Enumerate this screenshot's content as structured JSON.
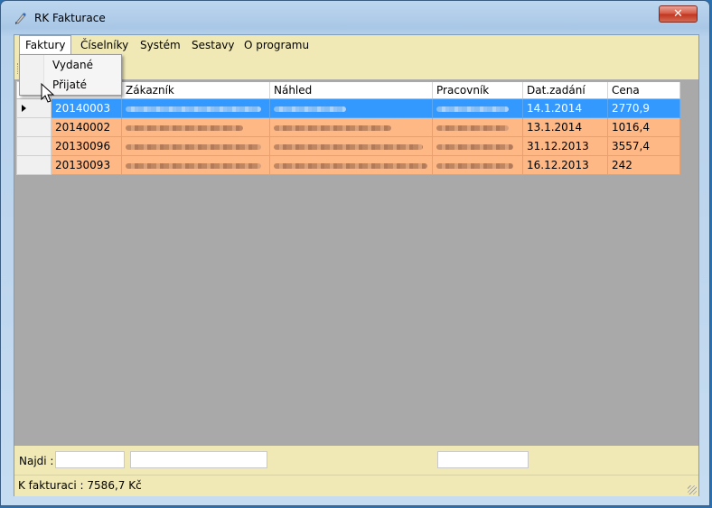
{
  "window": {
    "title": "RK Fakturace",
    "close_label": "✕"
  },
  "menu": {
    "items": [
      {
        "label": "Faktury",
        "active": true
      },
      {
        "label": "Číselníky"
      },
      {
        "label": "Systém"
      },
      {
        "label": "Sestavy"
      },
      {
        "label": "O programu"
      }
    ],
    "dropdown": [
      "Vydané",
      "Přijaté"
    ]
  },
  "grid": {
    "columns": [
      "",
      "Zákazník",
      "Náhled",
      "Pracovník",
      "Dat.zadání",
      "Cena"
    ],
    "rows": [
      {
        "id": "20140003",
        "date": "14.1.2014",
        "price": "2770,9",
        "selected": true
      },
      {
        "id": "20140002",
        "date": "13.1.2014",
        "price": "1016,4"
      },
      {
        "id": "20130096",
        "date": "31.12.2013",
        "price": "3557,4"
      },
      {
        "id": "20130093",
        "date": "16.12.2013",
        "price": "242"
      }
    ]
  },
  "search": {
    "label": "Najdi :"
  },
  "status": {
    "text": "K fakturaci : 7586,7 Kč"
  },
  "colors": {
    "row": "#fdb885",
    "selected": "#3399ff",
    "panel": "#f0e9b6"
  }
}
